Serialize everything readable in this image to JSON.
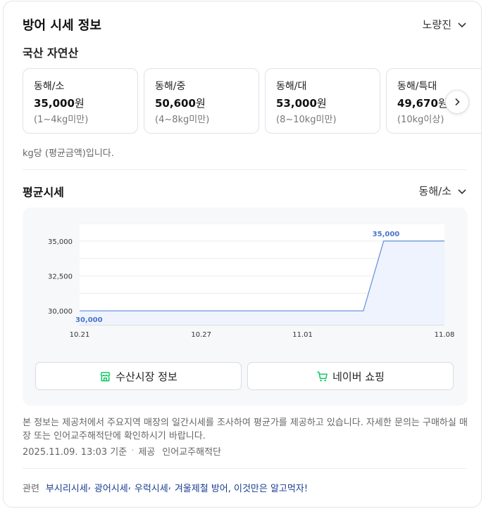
{
  "header": {
    "title": "방어 시세 정보",
    "market": "노량진"
  },
  "domestic": {
    "subtitle": "국산 자연산",
    "cards": [
      {
        "name": "동해/소",
        "price": "35,000",
        "currency": "원",
        "range": "(1~4kg미만)"
      },
      {
        "name": "동해/중",
        "price": "50,600",
        "currency": "원",
        "range": "(4~8kg미만)"
      },
      {
        "name": "동해/대",
        "price": "53,000",
        "currency": "원",
        "range": "(8~10kg미만)"
      },
      {
        "name": "동해/특대",
        "price": "49,670",
        "currency": "원",
        "range": "(10kg이상)"
      }
    ],
    "unit_note": "kg당 (평균금액)입니다."
  },
  "average": {
    "title": "평균시세",
    "selected_size": "동해/소"
  },
  "chart_data": {
    "type": "line",
    "x_labels": [
      "10.21",
      "10.27",
      "11.01",
      "11.08"
    ],
    "points": [
      {
        "x": "10.21",
        "y": 30000
      },
      {
        "x": "11.04",
        "y": 30000
      },
      {
        "x": "11.05",
        "y": 35000
      },
      {
        "x": "11.08",
        "y": 35000
      }
    ],
    "y_ticks": [
      "35,000",
      "32,500",
      "30,000"
    ],
    "ylim": [
      29000,
      36300
    ],
    "data_labels": [
      {
        "x": "10.21",
        "y": 30000,
        "text": "30,000"
      },
      {
        "x": "11.05",
        "y": 35000,
        "text": "35,000"
      }
    ],
    "grid": true,
    "line_color": "#6f95d8",
    "fill_color": "#eef3fd"
  },
  "buttons": {
    "fish_market": "수산시장 정보",
    "naver_shopping": "네이버 쇼핑"
  },
  "footer": {
    "description": "본 정보는 제공처에서 주요지역 매장의 일간시세를 조사하여 평균가를 제공하고 있습니다. 자세한 문의는 구매하실 매장 또는 인어교주해적단에 확인하시기 바랍니다.",
    "timestamp": "2025.11.09. 13:03 기준",
    "provider_label": "제공",
    "provider": "인어교주해적단",
    "related_label": "관련",
    "related_links": [
      "부시리시세",
      "광어시세",
      "우럭시세",
      "겨울제철 방어, 이것만은 알고먹자!"
    ]
  },
  "colors": {
    "accent_green": "#03c75a",
    "link_blue": "#1a3d8f"
  }
}
